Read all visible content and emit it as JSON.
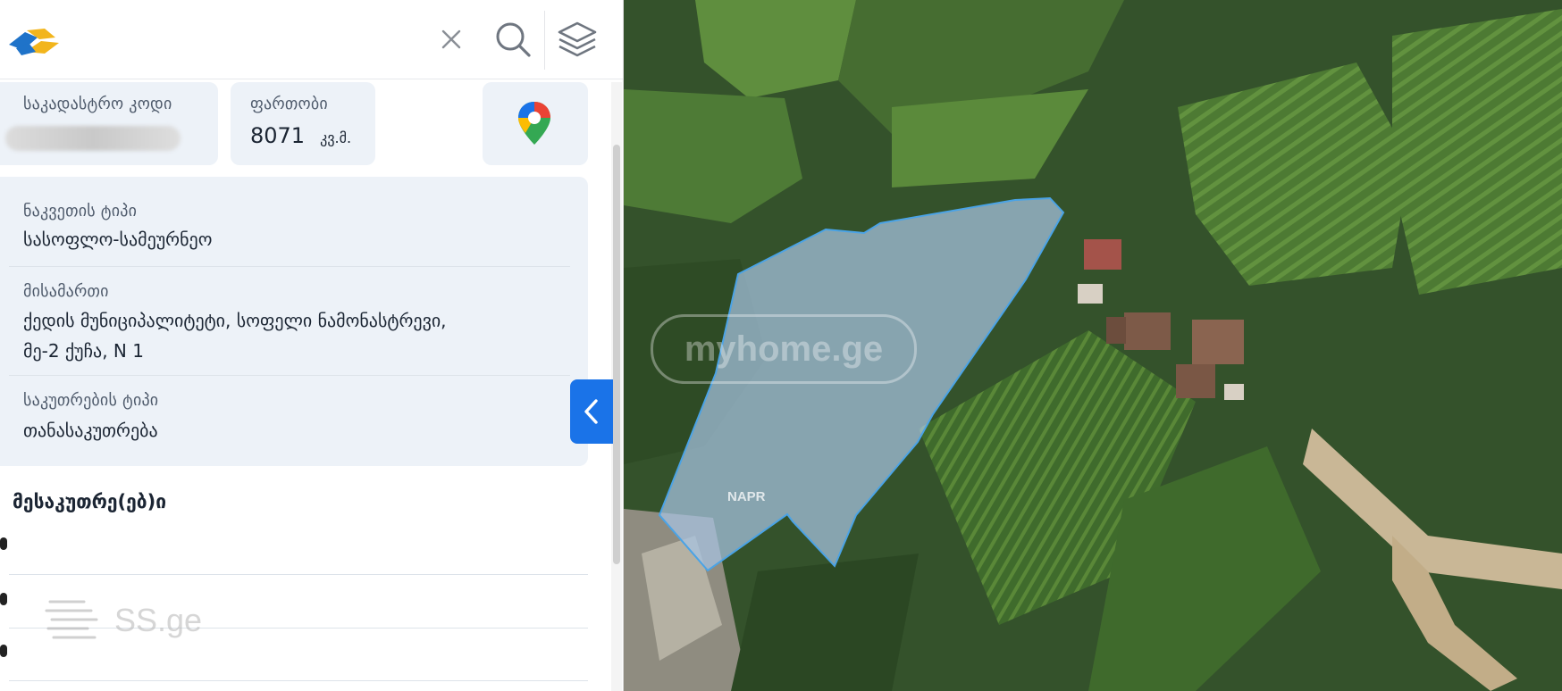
{
  "header": {
    "close_icon": "close-icon",
    "search_icon": "search-icon",
    "layers_icon": "layers-icon"
  },
  "cadastral": {
    "label": "საკადასტრო კოდი",
    "value_blurred": true
  },
  "area": {
    "label": "ფართობი",
    "value": "8071",
    "unit": "კვ.მ."
  },
  "details": {
    "plot_type_label": "ნაკვეთის ტიპი",
    "plot_type_value": "სასოფლო-სამეურნეო",
    "address_label": "მისამართი",
    "address_line1": "ქედის მუნიციპალიტეტი, სოფელი ნამონასტრევი,",
    "address_line2": "მე-2 ქუჩა, N 1",
    "ownership_label": "საკუთრების ტიპი",
    "ownership_value": "თანასაკუთრება"
  },
  "owners": {
    "heading": "მესაკუთრე(ებ)ი"
  },
  "map": {
    "napr_label": "NAPR",
    "watermark_myhome": "myhome.ge",
    "watermark_ss": "SS.ge",
    "parcel_fill": "#a8c4e2",
    "parcel_stroke": "#4aa3e6"
  },
  "colors": {
    "accent": "#1a73e8",
    "card_bg": "#edf2f8"
  }
}
